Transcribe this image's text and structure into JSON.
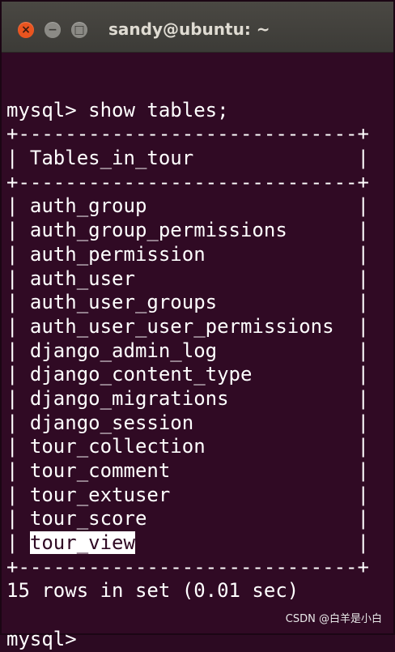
{
  "window": {
    "title": "sandy@ubuntu: ~",
    "buttons": {
      "close": "×",
      "minimize": "−",
      "maximize": "□"
    }
  },
  "terminal": {
    "lines": [
      "",
      "mysql> show tables;",
      "+-----------------------------+",
      "| Tables_in_tour              |",
      "+-----------------------------+",
      "| auth_group                  |",
      "| auth_group_permissions      |",
      "| auth_permission             |",
      "| auth_user                   |",
      "| auth_user_groups            |",
      "| auth_user_user_permissions  |",
      "| django_admin_log            |",
      "| django_content_type         |",
      "| django_migrations           |",
      "| django_session              |",
      "| tour_collection             |",
      "| tour_comment                |",
      "| tour_extuser                |",
      "| tour_score                  |",
      "| tour_view                   |",
      "+-----------------------------+",
      "15 rows in set (0.01 sec)",
      "",
      "mysql>"
    ],
    "highlighted_text": "tour_view"
  },
  "watermark": "CSDN @白羊是小白",
  "colors": {
    "background": "#300a24",
    "text": "#ffffff",
    "close_button": "#e9541f"
  }
}
